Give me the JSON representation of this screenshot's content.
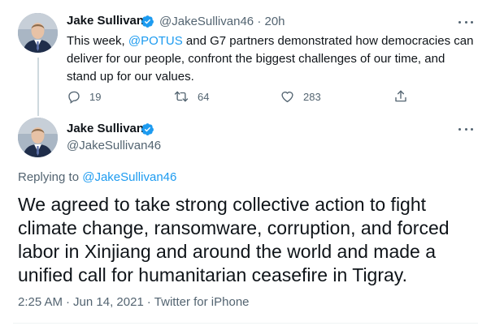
{
  "tweet1": {
    "author_name": "Jake Sullivan",
    "author_handle": "@JakeSullivan46",
    "separator": "·",
    "time": "20h",
    "text_before": "This week, ",
    "mention": "@POTUS",
    "text_after": " and G7 partners demonstrated how democracies can deliver for our people, confront the biggest challenges of our time, and stand up for our values.",
    "reply_count": "19",
    "retweet_count": "64",
    "like_count": "283"
  },
  "tweet2": {
    "author_name": "Jake Sullivan",
    "author_handle": "@JakeSullivan46",
    "replying_prefix": "Replying to ",
    "replying_to": "@JakeSullivan46",
    "text": "We agreed to take strong collective action to fight climate change, ransomware, corruption, and forced labor in Xinjiang and around the world and made a unified call for humanitarian ceasefire in Tigray.",
    "time": "2:25 AM",
    "separator1": "·",
    "date": "Jun 14, 2021",
    "separator2": "·",
    "source": "Twitter for iPhone"
  },
  "icons": {
    "verified": "verified-badge-icon",
    "more": "more-horizontal-icon",
    "reply": "reply-icon",
    "retweet": "retweet-icon",
    "like": "heart-icon",
    "share": "share-icon"
  },
  "colors": {
    "text": "#0f1419",
    "secondary": "#536471",
    "accent": "#1d9bf0",
    "thread_line": "#cfd9de"
  }
}
